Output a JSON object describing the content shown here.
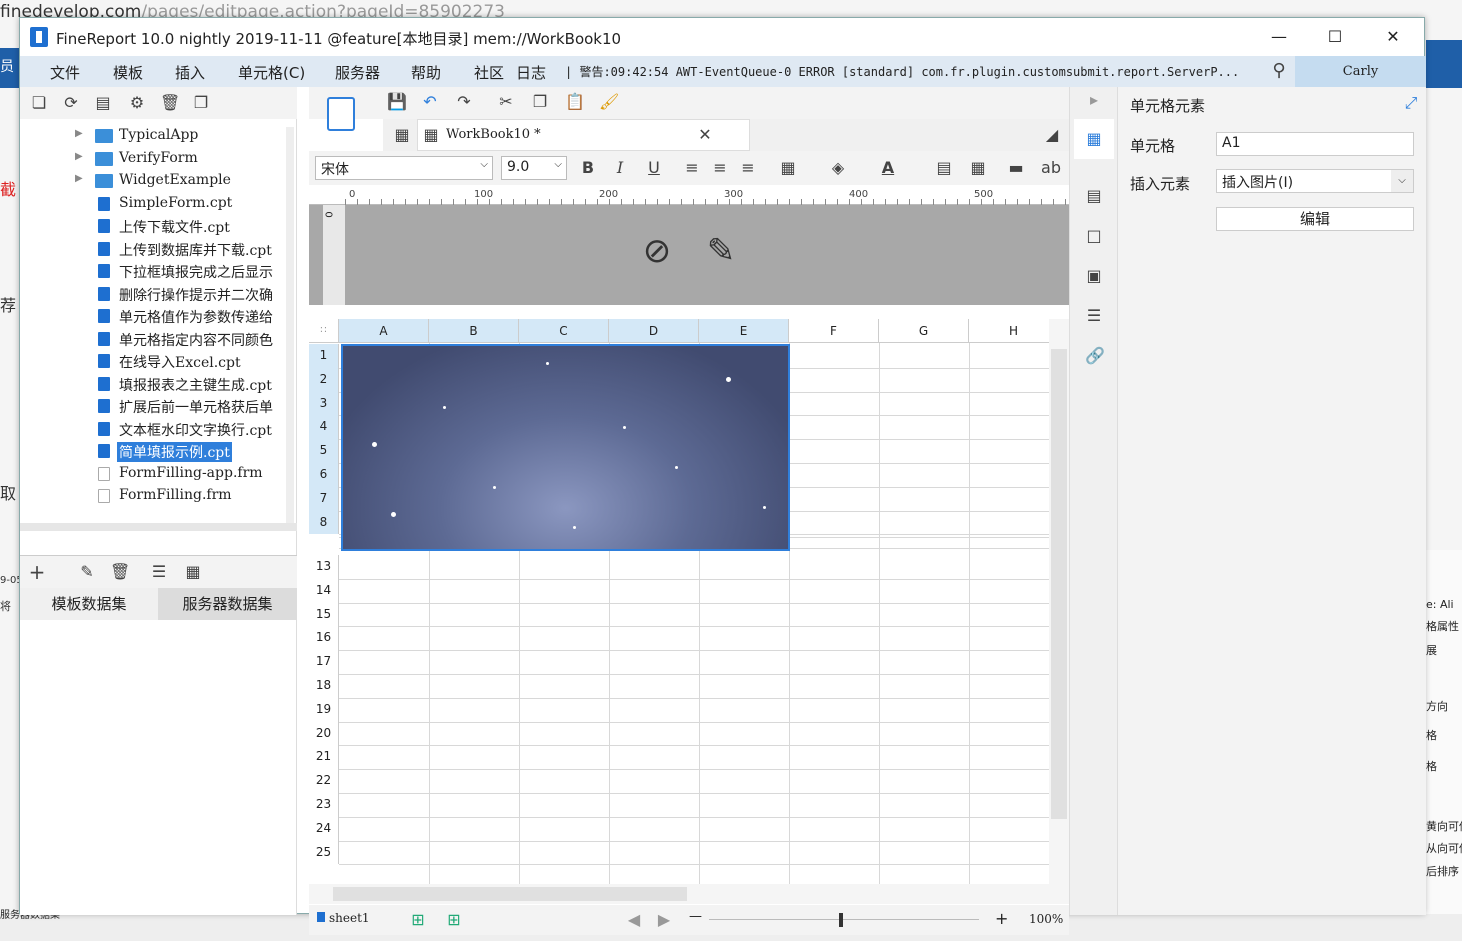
{
  "background": {
    "url_text": "finedevelop.com",
    "url_path": "/pages/editpage.action?pageId=85902273",
    "left_snippets": [
      "员",
      "截",
      "荐",
      "取",
      "9-05",
      "将"
    ],
    "right_panel_lines": [
      "e: Ali",
      "格属性",
      "展",
      "方向",
      "格",
      "格",
      "黄向可伸",
      "从向可伸",
      "后排序"
    ],
    "bottom_left": "服务器数据集"
  },
  "window": {
    "title": "FineReport 10.0 nightly 2019-11-11 @feature[本地目录]    mem://WorkBook10",
    "minimize_icon": "minimize-icon",
    "maximize_icon": "maximize-icon",
    "close_icon": "close-icon"
  },
  "menu": {
    "items": [
      "文件",
      "模板",
      "插入",
      "单元格(C)",
      "服务器",
      "帮助",
      "社区",
      "日志"
    ],
    "log_text": "| 警告:09:42:54 AWT-EventQueue-0 ERROR [standard] com.fr.plugin.customsubmit.report.ServerP...",
    "user": "Carly"
  },
  "tree": {
    "items": [
      {
        "label": "TypicalApp",
        "kind": "folder"
      },
      {
        "label": "VerifyForm",
        "kind": "folder"
      },
      {
        "label": "WidgetExample",
        "kind": "folder"
      },
      {
        "label": "SimpleForm.cpt",
        "kind": "file"
      },
      {
        "label": "上传下载文件.cpt",
        "kind": "file"
      },
      {
        "label": "上传到数据库并下载.cpt",
        "kind": "file"
      },
      {
        "label": "下拉框填报完成之后显示",
        "kind": "file"
      },
      {
        "label": "删除行操作提示并二次确",
        "kind": "file"
      },
      {
        "label": "单元格值作为参数传递给",
        "kind": "file"
      },
      {
        "label": "单元格指定内容不同颜色",
        "kind": "file"
      },
      {
        "label": "在线导入Excel.cpt",
        "kind": "file"
      },
      {
        "label": "填报报表之主键生成.cpt",
        "kind": "file"
      },
      {
        "label": "扩展后前一单元格获后单",
        "kind": "file"
      },
      {
        "label": "文本框水印文字换行.cpt",
        "kind": "file"
      },
      {
        "label": "简单填报示例.cpt",
        "kind": "file",
        "selected": true
      },
      {
        "label": "FormFilling-app.frm",
        "kind": "frm"
      },
      {
        "label": "FormFilling.frm",
        "kind": "frm"
      }
    ]
  },
  "datasets": {
    "tab_template": "模板数据集",
    "tab_server": "服务器数据集"
  },
  "editor": {
    "tab_name": "WorkBook10 *",
    "font_name": "宋体",
    "font_size": "9.0",
    "bold": "B",
    "italic": "I",
    "underline": "U",
    "wrap_label": "ab",
    "ruler_ticks": [
      "0",
      "100",
      "200",
      "300",
      "400",
      "500"
    ],
    "vruler_tick": "0",
    "columns": [
      "A",
      "B",
      "C",
      "D",
      "E",
      "F",
      "G",
      "H"
    ],
    "rows": [
      "1",
      "2",
      "3",
      "4",
      "5",
      "6",
      "7",
      "8",
      "13",
      "14",
      "15",
      "16",
      "17",
      "18",
      "19",
      "20",
      "21",
      "22",
      "23",
      "24",
      "25"
    ],
    "sheet_name": "sheet1",
    "zoom": "100%",
    "zoom_minus": "—",
    "zoom_plus": "+"
  },
  "cell_panel": {
    "title": "单元格元素",
    "cell_label": "单元格",
    "cell_value": "A1",
    "insert_label": "插入元素",
    "insert_value": "插入图片(I)",
    "edit_button": "编辑"
  }
}
